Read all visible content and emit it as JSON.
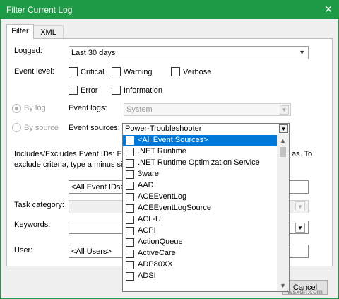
{
  "window": {
    "title": "Filter Current Log",
    "close_glyph": "✕",
    "accent": "#1f9b48"
  },
  "tabs": [
    {
      "label": "Filter"
    },
    {
      "label": "XML"
    }
  ],
  "filter": {
    "logged_label": "Logged:",
    "logged_value": "Last 30 days",
    "event_level_label": "Event level:",
    "levels": {
      "critical": "Critical",
      "warning": "Warning",
      "verbose": "Verbose",
      "error": "Error",
      "information": "Information"
    },
    "by_log_label": "By log",
    "by_source_label": "By source",
    "event_logs_label": "Event logs:",
    "event_logs_value": "System",
    "event_sources_label": "Event sources:",
    "event_sources_value": "Power-Troubleshooter",
    "includes_text_1": "Includes/Excludes Event IDs: Ente",
    "includes_text_1_right": "as. To",
    "includes_text_2": "exclude criteria, type a minus sig",
    "event_ids_value": "<All Event IDs>",
    "task_category_label": "Task category:",
    "keywords_label": "Keywords:",
    "user_label": "User:",
    "user_value": "<All Users>"
  },
  "sources_list": {
    "items": [
      "<All Event Sources>",
      ".NET Runtime",
      ".NET Runtime Optimization Service",
      "3ware",
      "AAD",
      "ACEEventLog",
      "ACEEventLogSource",
      "ACL-UI",
      "ACPI",
      "ActionQueue",
      "ActiveCare",
      "ADP80XX",
      "ADSI"
    ],
    "selected_index": 0,
    "selected_color": "#0078d7"
  },
  "buttons": {
    "cancel": "Cancel"
  },
  "watermark": "wsxdn.com"
}
